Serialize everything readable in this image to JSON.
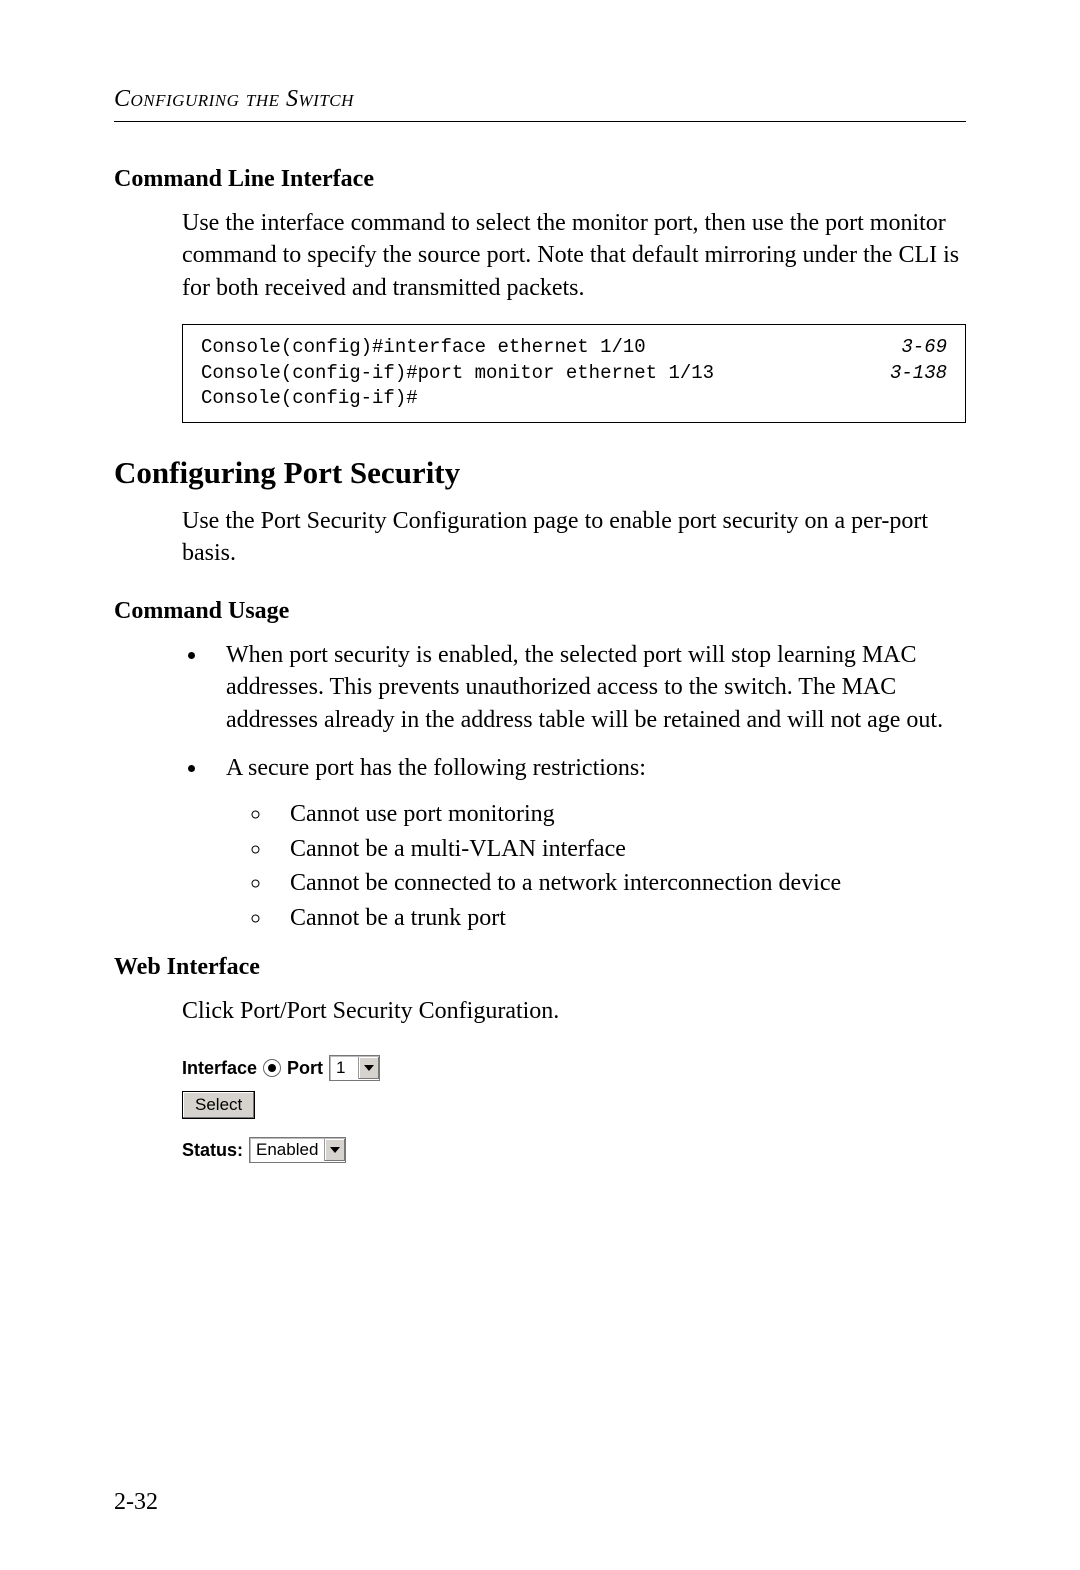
{
  "runningHead": "Configuring the Switch",
  "section1": {
    "heading": "Command Line Interface",
    "paragraph": "Use the interface command to select the monitor port, then use the port monitor command to specify the source port. Note that default mirroring under the CLI is for both received and transmitted packets."
  },
  "codebox": {
    "lines": [
      {
        "cmd": "Console(config)#interface ethernet 1/10",
        "ref": "3-69"
      },
      {
        "cmd": "Console(config-if)#port monitor ethernet 1/13",
        "ref": "3-138"
      },
      {
        "cmd": "Console(config-if)#",
        "ref": ""
      }
    ]
  },
  "section2": {
    "heading": "Configuring Port Security",
    "paragraph": "Use the Port Security Configuration page to enable port security on a per-port basis."
  },
  "section3": {
    "heading": "Command Usage",
    "bullets": [
      "When port security is enabled, the selected port will stop learning MAC addresses. This prevents unauthorized access to the switch. The MAC addresses already in the address table will be retained and will not age out.",
      "A secure port has the following restrictions:"
    ],
    "subbullets": [
      "Cannot use port monitoring",
      "Cannot be a multi-VLAN interface",
      "Cannot be connected to a network interconnection device",
      "Cannot be a trunk port"
    ]
  },
  "section4": {
    "heading": "Web Interface",
    "paragraph": "Click Port/Port Security Configuration."
  },
  "ui": {
    "interfaceLabel": "Interface",
    "portLabel": "Port",
    "portValue": "1",
    "selectLabel": "Select",
    "statusLabel": "Status:",
    "statusValue": "Enabled"
  },
  "pageNumber": "2-32"
}
